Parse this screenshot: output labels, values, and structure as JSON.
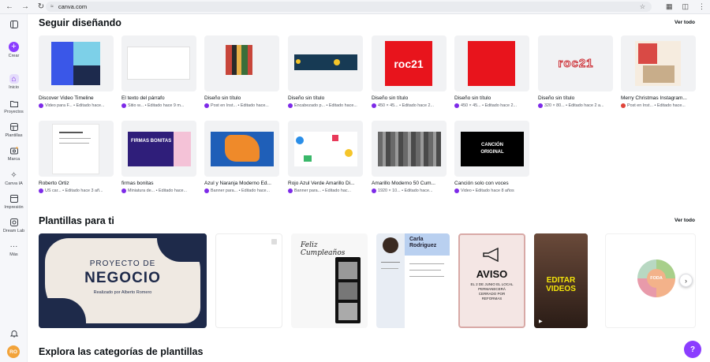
{
  "browser": {
    "url": "canva.com"
  },
  "sidebar": {
    "items": [
      {
        "label": "Crear",
        "icon": "plus-icon"
      },
      {
        "label": "Inicio",
        "icon": "home-icon"
      },
      {
        "label": "Proyectos",
        "icon": "folder-icon"
      },
      {
        "label": "Plantillas",
        "icon": "templates-icon"
      },
      {
        "label": "Marca",
        "icon": "brand-icon"
      },
      {
        "label": "Canva IA",
        "icon": "sparkle-icon"
      },
      {
        "label": "Impresión",
        "icon": "print-icon"
      },
      {
        "label": "Dream Lab",
        "icon": "dream-lab-icon"
      },
      {
        "label": "Más",
        "icon": "more-icon"
      }
    ],
    "avatar_initials": "RO"
  },
  "sections": {
    "continue_title": "Seguir diseñando",
    "continue_see_all": "Ver todo",
    "templates_title": "Plantillas para ti",
    "templates_see_all": "Ver todo",
    "categories_title": "Explora las categorías de plantillas"
  },
  "designs": [
    {
      "title": "Discover Video Timeline",
      "meta": "Video para F... • Editado hace..."
    },
    {
      "title": "El texto del párrafo",
      "meta": "Sitio w... • Editado hace 9 m..."
    },
    {
      "title": "Diseño sin título",
      "meta": "Post en Inst... • Editado hace..."
    },
    {
      "title": "Diseño sin título",
      "meta": "Encabezado p... • Editado hace..."
    },
    {
      "title": "Diseño sin título",
      "meta": "450 × 45... • Editado hace 2..."
    },
    {
      "title": "Diseño sin título",
      "meta": "450 × 45... • Editado hace 2..."
    },
    {
      "title": "Diseño sin título",
      "meta": "320 × 80... • Editado hace 2 a..."
    },
    {
      "title": "Merry Christmas Instagram...",
      "meta": "Post en Inst... • Editado hace..."
    },
    {
      "title": "Roberto Ortiz",
      "meta": "US car... • Editado hace 3 añ..."
    },
    {
      "title": "firmas bonitas",
      "meta": "Miniatura de... • Editado hace..."
    },
    {
      "title": "Azul y Naranja Moderno Ed...",
      "meta": "Banner para... • Editado hace..."
    },
    {
      "title": "Rojo Azul Verde Amarillo Di...",
      "meta": "Banner para... • Editado hac..."
    },
    {
      "title": "Amarillo Moderno 50 Cum...",
      "meta": "1920 × 10... • Editado hace..."
    },
    {
      "title": "Canción solo con voces",
      "meta": "Video • Editado hace 8 años"
    }
  ],
  "thumb_text": {
    "roc21": "roc21",
    "roc21_outline": "roc21",
    "firmas": "FIRMAS BONITAS",
    "cancion": "CANCIÓN ORIGINAL"
  },
  "templates": {
    "negocio_small": "PROYECTO DE",
    "negocio_big": "NEGOCIO",
    "negocio_sub": "Realizado por Alberto Romero",
    "cumple": "Feliz Cumpleaños",
    "cv_name": "Carla Rodriguez",
    "aviso_title": "AVISO",
    "aviso_text": "EL 2 DE JUNIO EL LOCAL PERMANECERÁ CERRADO POR REFORMAS",
    "video_text": "EDITAR VIDEOS",
    "foda": "FODA"
  },
  "colors": {
    "brand": "#8b3dff",
    "navy": "#1e2a4a"
  }
}
